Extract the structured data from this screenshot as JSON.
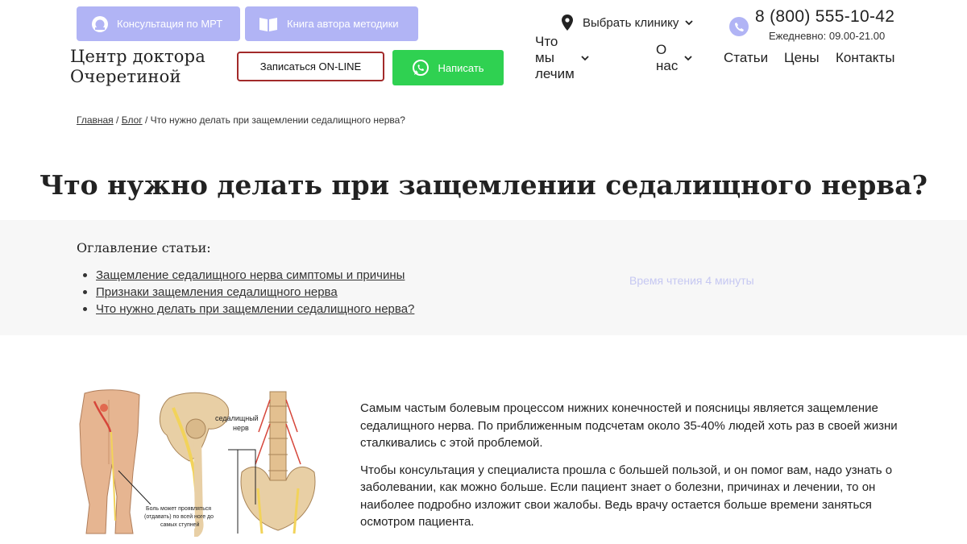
{
  "header": {
    "mri_button": "Консультация по МРТ",
    "book_button": "Книга автора методики",
    "logo_line1": "Центр доктора",
    "logo_line2": "Очеретиной",
    "online_button": "Записаться ON-LINE",
    "write_button": "Написать",
    "clinic_select": "Выбрать клинику",
    "phone": "8 (800) 555-10-42",
    "hours": "Ежедневно: 09.00-21.00",
    "nav": {
      "what_we_treat": "Что мы лечим",
      "about": "О нас",
      "articles": "Статьи",
      "prices": "Цены",
      "contacts": "Контакты"
    }
  },
  "breadcrumb": {
    "home": "Главная",
    "sep1": " / ",
    "blog": "Блог",
    "sep2": " / ",
    "current": "Что нужно делать при защемлении седалищного нерва?"
  },
  "page_title": "Что нужно делать при защемлении седалищного нерва?",
  "toc": {
    "title": "Оглавление статьи:",
    "items": [
      "Защемление седалищного нерва симптомы и причины",
      "Признаки защемления седалищного нерва",
      "Что нужно делать при защемлении седалищного нерва?"
    ],
    "reading_time": "Время чтения 4 минуты"
  },
  "figure": {
    "label_nerve_1": "седалищный",
    "label_nerve_2": "нерв",
    "caption_1": "Боль может проявляться",
    "caption_2": "(отдавать) по всей ноге до",
    "caption_3": "самых ступней"
  },
  "article": {
    "p1": "Самым частым болевым процессом нижних конечностей и поясницы является защемление седалищного нерва. По приближенным подсчетам около 35-40% людей хоть раз в своей жизни сталкивались с этой проблемой.",
    "p2": "Чтобы консультация у специалиста прошла с большей пользой, и он помог вам, надо узнать о заболевании, как можно больше. Если пациент знает о болезни, причинах и лечении, то он наиболее подробно изложит свои жалобы. Ведь врачу остается больше времени заняться осмотром пациента."
  },
  "colors": {
    "accent": "#b1b4f5",
    "whatsapp_green": "#2fd151",
    "online_border": "#a22a2a",
    "toc_bg": "#f7f7f7"
  },
  "icons": [
    "mri-icon",
    "book-icon",
    "whatsapp-icon",
    "location-pin-icon",
    "chevron-down-icon",
    "phone-icon"
  ]
}
